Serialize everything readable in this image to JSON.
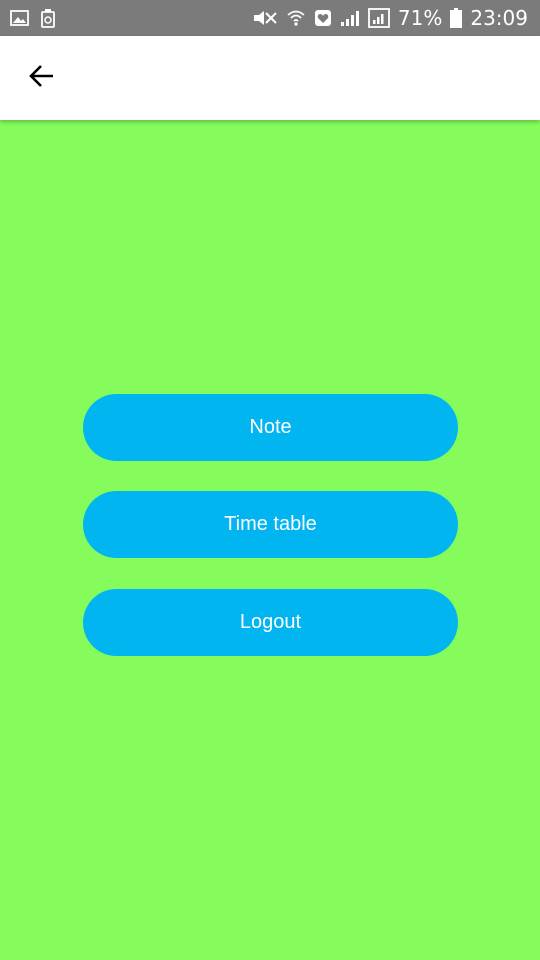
{
  "status_bar": {
    "battery_percent": "71%",
    "time": "23:09",
    "icons": [
      "image-icon",
      "recycle-icon",
      "mute-icon",
      "wifi-icon",
      "heart-icon",
      "signal-icon",
      "signal-box-icon",
      "battery-icon"
    ]
  },
  "app_bar": {
    "back_icon": "arrow-back-icon"
  },
  "menu": {
    "buttons": [
      {
        "label": "Note"
      },
      {
        "label": "Time table"
      },
      {
        "label": "Logout"
      }
    ]
  },
  "colors": {
    "background": "#85FC5C",
    "button": "#00B5F0",
    "status_bar": "#7b7b7b",
    "app_bar": "#ffffff"
  }
}
